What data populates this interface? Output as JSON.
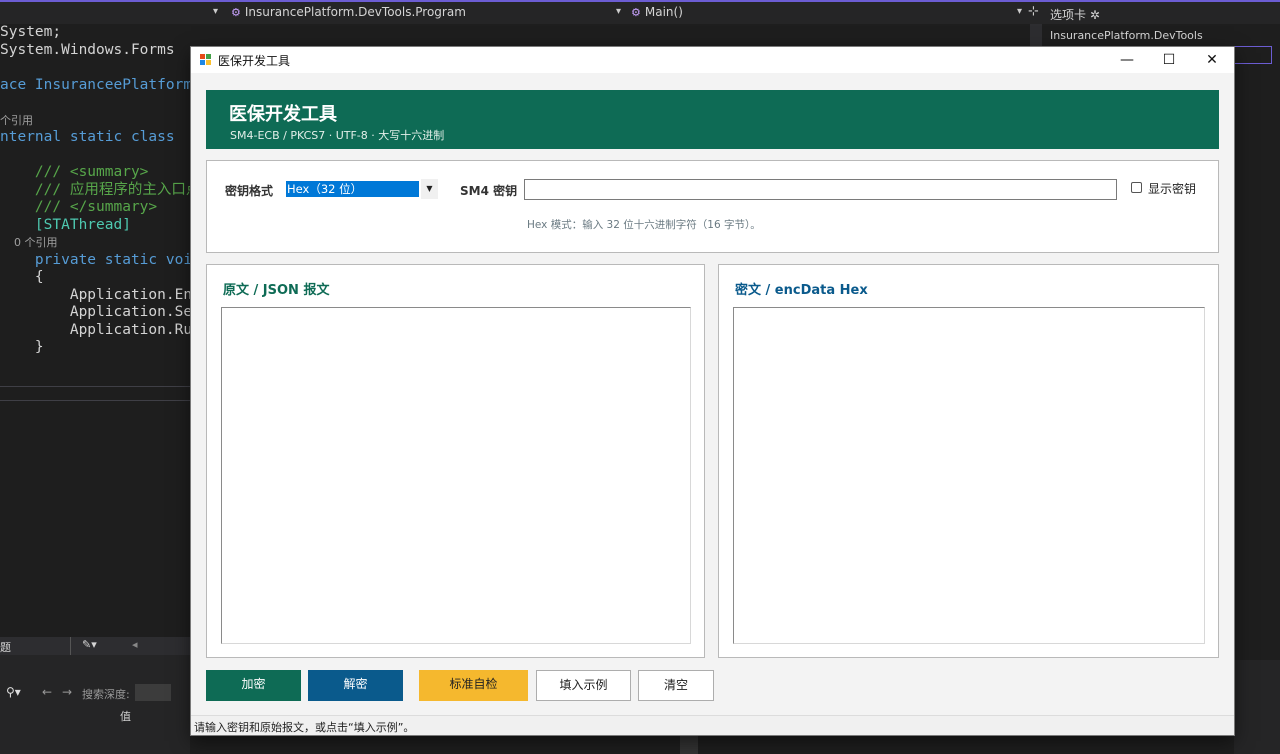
{
  "ide": {
    "nav_dropdown_left": "▾",
    "class_nav": "InsurancePlatform.DevTools.Program",
    "member_nav": "Main()",
    "tabs_label": "选项卡",
    "solution_item": "InsurancePlatform.DevTools",
    "code_lines": [
      {
        "kind": "plain",
        "text": "System;"
      },
      {
        "kind": "plain",
        "text": "System.Windows.Forms"
      },
      {
        "kind": "blank",
        "text": ""
      },
      {
        "kind": "ns",
        "text": "ace InsuranceePlatform"
      },
      {
        "kind": "blank",
        "text": ""
      },
      {
        "kind": "ref",
        "text": "个引用"
      },
      {
        "kind": "cls",
        "text": "nternal static class"
      },
      {
        "kind": "blank",
        "text": ""
      },
      {
        "kind": "cm",
        "text": "    /// <summary>"
      },
      {
        "kind": "cm",
        "text": "    /// 应用程序的主入口点"
      },
      {
        "kind": "cm",
        "text": "    /// </summary>"
      },
      {
        "kind": "attr",
        "text": "    [STAThread]"
      },
      {
        "kind": "ref",
        "text": "    0 个引用"
      },
      {
        "kind": "kw",
        "text": "    private static voi"
      },
      {
        "kind": "plain",
        "text": "    {"
      },
      {
        "kind": "plain",
        "text": "        Application.En"
      },
      {
        "kind": "plain",
        "text": "        Application.Se"
      },
      {
        "kind": "plain",
        "text": "        Application.Ru"
      },
      {
        "kind": "plain",
        "text": "    }"
      }
    ],
    "bottom_toolbar_label": "题",
    "search_depth_label": "搜索深度:",
    "value_col_label": "值"
  },
  "window": {
    "title": "医保开发工具"
  },
  "header": {
    "title": "医保开发工具",
    "subtitle": "SM4-ECB / PKCS7 · UTF-8 · 大写十六进制"
  },
  "key_panel": {
    "format_label": "密钥格式",
    "format_selected": "Hex（32 位）",
    "key_label": "SM4 密钥",
    "key_value": "",
    "show_key_label": "显示密钥",
    "show_key_checked": false,
    "hint": "Hex 模式：输入 32 位十六进制字符（16 字节）。"
  },
  "panels": {
    "plain": {
      "title": "原文 / JSON 报文",
      "title_color": "#0e6b55",
      "content": ""
    },
    "cipher": {
      "title": "密文 / encData Hex",
      "title_color": "#0a5a8c",
      "content": ""
    }
  },
  "buttons": {
    "encrypt": "加密",
    "decrypt": "解密",
    "selftest": "标准自检",
    "sample": "填入示例",
    "clear": "清空"
  },
  "colors": {
    "encrypt": "#0e6b55",
    "decrypt": "#0a5a8c",
    "selftest": "#f5b82e"
  },
  "status": "请输入密钥和原始报文，或点击“填入示例”。"
}
